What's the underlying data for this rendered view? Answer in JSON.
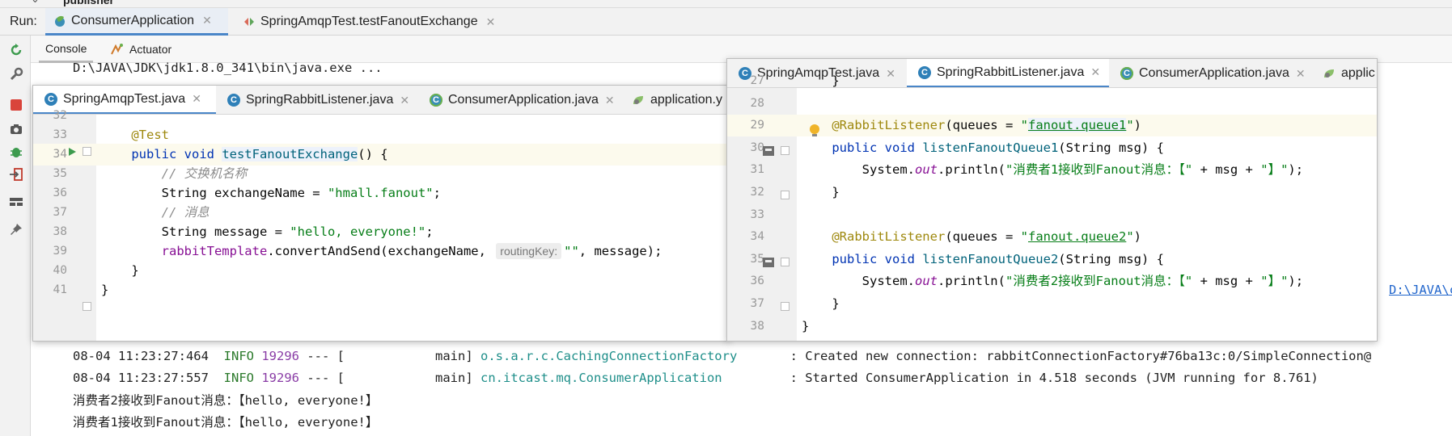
{
  "top": {
    "project": "publisher"
  },
  "run": {
    "label": "Run:",
    "tabs": [
      {
        "label": "ConsumerApplication",
        "icon": "spring-app-icon"
      },
      {
        "label": "SpringAmqpTest.testFanoutExchange",
        "icon": "test-run-icon"
      }
    ]
  },
  "console": {
    "tabs": [
      "Console",
      "Actuator"
    ],
    "command": "D:\\JAVA\\JDK\\jdk1.8.0_341\\bin\\java.exe ...",
    "overflow_link": "D:\\JAVA\\cod",
    "logs": [
      {
        "time": "08-04 11:23:27:464",
        "level": "INFO",
        "pid": "19296",
        "sep": "--- [",
        "thread": "main]",
        "logger": "o.s.a.r.c.CachingConnectionFactory",
        "message": ": Created new connection: rabbitConnectionFactory#76ba13c:0/SimpleConnection@"
      },
      {
        "time": "08-04 11:23:27:557",
        "level": "INFO",
        "pid": "19296",
        "sep": "--- [",
        "thread": "main]",
        "logger": "cn.itcast.mq.ConsumerApplication",
        "message": ": Started ConsumerApplication in 4.518 seconds (JVM running for 8.761)"
      }
    ],
    "outputs": [
      "消费者2接收到Fanout消息：【hello, everyone!】",
      "消费者1接收到Fanout消息：【hello, everyone!】"
    ]
  },
  "editor_left": {
    "tabs": [
      "SpringAmqpTest.java",
      "SpringRabbitListener.java",
      "ConsumerApplication.java",
      "application.y"
    ],
    "lines": [
      {
        "n": "32",
        "parts": []
      },
      {
        "n": "33",
        "parts": [
          {
            "t": "    "
          },
          {
            "t": "@Test",
            "c": "ann"
          }
        ]
      },
      {
        "n": "34",
        "parts": [
          {
            "t": "    "
          },
          {
            "t": "public void ",
            "c": "kw"
          },
          {
            "t": "testFanoutExchange",
            "c": "mth hlbox"
          },
          {
            "t": "() {"
          }
        ]
      },
      {
        "n": "35",
        "parts": [
          {
            "t": "        "
          },
          {
            "t": "// 交换机名称",
            "c": "cmt"
          }
        ]
      },
      {
        "n": "36",
        "parts": [
          {
            "t": "        String exchangeName = "
          },
          {
            "t": "\"hmall.fanout\"",
            "c": "str"
          },
          {
            "t": ";"
          }
        ]
      },
      {
        "n": "37",
        "parts": [
          {
            "t": "        "
          },
          {
            "t": "// 消息",
            "c": "cmt"
          }
        ]
      },
      {
        "n": "38",
        "parts": [
          {
            "t": "        String message = "
          },
          {
            "t": "\"hello, everyone!\"",
            "c": "str"
          },
          {
            "t": ";"
          }
        ]
      },
      {
        "n": "39",
        "parts": [
          {
            "t": "        "
          },
          {
            "t": "rabbitTemplate",
            "c": "fld"
          },
          {
            "t": ".convertAndSend(exchangeName, "
          },
          {
            "t": "routingKey:",
            "c": "hint"
          },
          {
            "t": "\"\"",
            "c": "str"
          },
          {
            "t": ", message);"
          }
        ]
      },
      {
        "n": "40",
        "parts": [
          {
            "t": "    }"
          }
        ]
      },
      {
        "n": "41",
        "parts": [
          {
            "t": "}"
          }
        ]
      }
    ]
  },
  "editor_right": {
    "tabs": [
      "SpringAmqpTest.java",
      "SpringRabbitListener.java",
      "ConsumerApplication.java",
      "applic"
    ],
    "lines": [
      {
        "n": "27",
        "parts": [
          {
            "t": "    }"
          }
        ]
      },
      {
        "n": "28",
        "parts": []
      },
      {
        "n": "29",
        "parts": [
          {
            "t": "    "
          },
          {
            "t": "@RabbitListener",
            "c": "ann"
          },
          {
            "t": "(queues = "
          },
          {
            "t": "\"",
            "c": "str"
          },
          {
            "t": "fanout.queue1",
            "c": "str under hlbox"
          },
          {
            "t": "\"",
            "c": "str"
          },
          {
            "t": ")"
          }
        ]
      },
      {
        "n": "30",
        "parts": [
          {
            "t": "    "
          },
          {
            "t": "public void ",
            "c": "kw"
          },
          {
            "t": "listenFanoutQueue1",
            "c": "mth"
          },
          {
            "t": "(String msg) {"
          }
        ]
      },
      {
        "n": "31",
        "parts": [
          {
            "t": "        System."
          },
          {
            "t": "out",
            "c": "italic-fld"
          },
          {
            "t": ".println("
          },
          {
            "t": "\"消费者1接收到Fanout消息：【\"",
            "c": "str"
          },
          {
            "t": " + msg + "
          },
          {
            "t": "\"】\"",
            "c": "str"
          },
          {
            "t": ");"
          }
        ]
      },
      {
        "n": "32",
        "parts": [
          {
            "t": "    }"
          }
        ]
      },
      {
        "n": "33",
        "parts": []
      },
      {
        "n": "34",
        "parts": [
          {
            "t": "    "
          },
          {
            "t": "@RabbitListener",
            "c": "ann"
          },
          {
            "t": "(queues = "
          },
          {
            "t": "\"",
            "c": "str"
          },
          {
            "t": "fanout.queue2",
            "c": "str under"
          },
          {
            "t": "\"",
            "c": "str"
          },
          {
            "t": ")"
          }
        ]
      },
      {
        "n": "35",
        "parts": [
          {
            "t": "    "
          },
          {
            "t": "public void ",
            "c": "kw"
          },
          {
            "t": "listenFanoutQueue2",
            "c": "mth"
          },
          {
            "t": "(String msg) {"
          }
        ]
      },
      {
        "n": "36",
        "parts": [
          {
            "t": "        System."
          },
          {
            "t": "out",
            "c": "italic-fld"
          },
          {
            "t": ".println("
          },
          {
            "t": "\"消费者2接收到Fanout消息：【\"",
            "c": "str"
          },
          {
            "t": " + msg + "
          },
          {
            "t": "\"】\"",
            "c": "str"
          },
          {
            "t": ");"
          }
        ]
      },
      {
        "n": "37",
        "parts": [
          {
            "t": "    }"
          }
        ]
      },
      {
        "n": "38",
        "parts": [
          {
            "t": "}"
          }
        ]
      }
    ]
  },
  "colors": {
    "accent": "#4a86c8",
    "keyword": "#0033b3",
    "string": "#067d17",
    "annotation": "#9e880d",
    "field": "#871094",
    "method": "#00627a",
    "comment": "#8c8c8c",
    "log_info": "#2b7a2b",
    "log_pid": "#8a3da6",
    "log_logger": "#1f8f8a"
  }
}
